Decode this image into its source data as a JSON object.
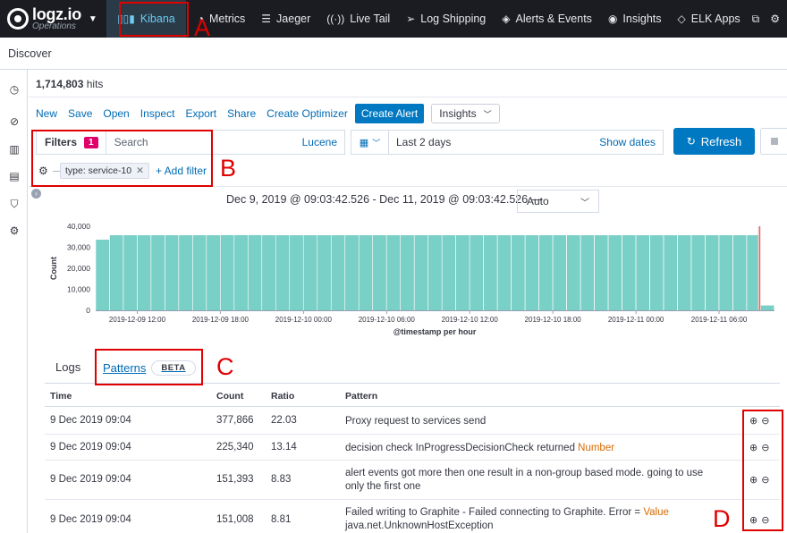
{
  "brand": {
    "name": "logz.io",
    "sub": "Operations"
  },
  "nav": [
    {
      "icon": "kibana-icon",
      "glyph": "▯▯▮",
      "label": "Kibana",
      "active": true
    },
    {
      "icon": "metrics-icon",
      "glyph": "◔",
      "label": "Metrics"
    },
    {
      "icon": "jaeger-icon",
      "glyph": "☰",
      "label": "Jaeger"
    },
    {
      "icon": "live-tail-icon",
      "glyph": "((·))",
      "label": "Live Tail"
    },
    {
      "icon": "log-shipping-icon",
      "glyph": "➢",
      "label": "Log Shipping"
    },
    {
      "icon": "alerts-icon",
      "glyph": "◈",
      "label": "Alerts & Events"
    },
    {
      "icon": "insights-icon",
      "glyph": "◉",
      "label": "Insights"
    },
    {
      "icon": "elk-apps-icon",
      "glyph": "◇",
      "label": "ELK Apps"
    }
  ],
  "page": {
    "title": "Discover"
  },
  "hits": {
    "count": "1,714,803",
    "label": "hits"
  },
  "toolbar": {
    "links": [
      "New",
      "Save",
      "Open",
      "Inspect",
      "Export",
      "Share",
      "Create Optimizer"
    ],
    "create_alert": "Create Alert",
    "insights": "Insights"
  },
  "query": {
    "filters_label": "Filters",
    "filters_count": "1",
    "search_placeholder": "Search",
    "syntax": "Lucene",
    "date_range": "Last 2 days",
    "show_dates": "Show dates",
    "refresh": "Refresh",
    "filter_pill": "type: service-10",
    "add_filter": "+ Add filter"
  },
  "histogram": {
    "time_range": "Dec 9, 2019 @ 09:03:42.526 - Dec 11, 2019 @ 09:03:42.526 —",
    "interval": "Auto"
  },
  "chart_data": {
    "type": "bar",
    "ylabel": "Count",
    "xlabel": "@timestamp per hour",
    "ylim": [
      0,
      40000
    ],
    "yticks": [
      "0",
      "10,000",
      "20,000",
      "30,000",
      "40,000"
    ],
    "xticks": [
      "2019-12-09 12:00",
      "2019-12-09 18:00",
      "2019-12-10 00:00",
      "2019-12-10 06:00",
      "2019-12-10 12:00",
      "2019-12-10 18:00",
      "2019-12-11 00:00",
      "2019-12-11 06:00"
    ],
    "bar_color": "#78d0c6",
    "values": [
      33500,
      35600,
      35600,
      35600,
      35600,
      35600,
      35600,
      35600,
      35600,
      35700,
      35700,
      35700,
      35600,
      35600,
      35600,
      35600,
      35600,
      35600,
      35600,
      35600,
      35600,
      35600,
      35600,
      35600,
      35600,
      35600,
      35600,
      35600,
      35600,
      35600,
      35600,
      35600,
      35600,
      35600,
      35600,
      35600,
      35600,
      35600,
      35600,
      35600,
      35600,
      35600,
      35600,
      35600,
      35600,
      35600,
      35600,
      35600,
      2200
    ]
  },
  "tabs": {
    "logs": "Logs",
    "patterns": "Patterns",
    "beta": "BETA"
  },
  "table": {
    "headers": {
      "time": "Time",
      "count": "Count",
      "ratio": "Ratio",
      "pattern": "Pattern"
    },
    "rows": [
      {
        "time": "9 Dec 2019 09:04",
        "count": "377,866",
        "ratio": "22.03",
        "pattern": "Proxy request to services send",
        "highlight": ""
      },
      {
        "time": "9 Dec 2019 09:04",
        "count": "225,340",
        "ratio": "13.14",
        "pattern": "decision check InProgressDecisionCheck returned ",
        "highlight": "Number"
      },
      {
        "time": "9 Dec 2019 09:04",
        "count": "151,393",
        "ratio": "8.83",
        "pattern": "alert events got more then one result in a non-group based mode. going to use only the first one",
        "highlight": ""
      },
      {
        "time": "9 Dec 2019 09:04",
        "count": "151,008",
        "ratio": "8.81",
        "pattern": "Failed writing to Graphite - Failed connecting to Graphite. Error = ",
        "highlight": "Value",
        "pattern_tail": "java.net.UnknownHostException"
      }
    ]
  },
  "annotations": {
    "a": "A",
    "b": "B",
    "c": "C",
    "d": "D"
  }
}
